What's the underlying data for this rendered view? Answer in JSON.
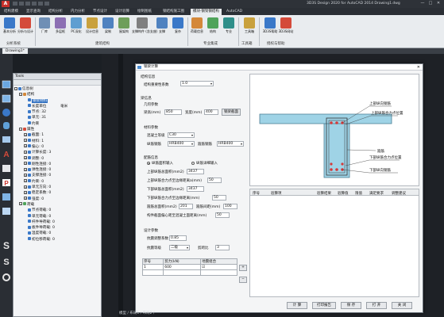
{
  "titlebar": {
    "logo": "A",
    "window_title": "3D3S Design 2020 for AutoCAD 2014   Drawing1.dwg",
    "minimize": "—",
    "maximize": "□",
    "close": "✕"
  },
  "menu_tabs": [
    "结构建模",
    "显示查询",
    "结构分析",
    "内力分析",
    "节点设计",
    "设计验算",
    "绘制图纸",
    "钢结构施工图",
    "模块·钢架钢结构",
    "AutoCAD"
  ],
  "ribbon": {
    "buttons": [
      {
        "label": "基本分析",
        "color": "#3a78c8"
      },
      {
        "label": "分析与设计",
        "color": "#d44a3a"
      },
      {
        "label": "厂库",
        "color": "#6f8fb5"
      },
      {
        "label": "多层框",
        "color": "#8c6fb3"
      },
      {
        "label": "PC深化",
        "color": "#5f9ed1"
      },
      {
        "label": "设计信息",
        "color": "#c9a13d"
      },
      {
        "label": "梁制",
        "color": "#4f82c0"
      },
      {
        "label": "屋架构",
        "color": "#6e9e5a"
      },
      {
        "label": "支撑构件 (含支座)",
        "color": "#7f7f7f"
      },
      {
        "label": "支撑",
        "color": "#4f82c0"
      },
      {
        "label": "复杂",
        "color": "#3a78c8"
      },
      {
        "label": "荷载信息",
        "color": "#d4883a"
      },
      {
        "label": "结构",
        "color": "#4fa35a"
      },
      {
        "label": "专业",
        "color": "#2f8f8a"
      },
      {
        "label": "工具箱",
        "color": "#c9a13d"
      },
      {
        "label": "3D3S帮助",
        "color": "#3a78c8"
      },
      {
        "label": "3D3S网站",
        "color": "#d44a3a"
      }
    ],
    "groups": [
      "分析系统",
      "建筑结构",
      "专业集成",
      "工具箱",
      "授权与帮助"
    ]
  },
  "doc_tab": "Drawing1*",
  "panel": {
    "title": "Tools",
    "tree": [
      {
        "indent": 0,
        "box": "−",
        "text": "信息树",
        "value": "",
        "icon": "#3a78c8"
      },
      {
        "indent": 1,
        "box": "−",
        "text": "结构",
        "value": "",
        "icon": "#d4883a"
      },
      {
        "indent": 2,
        "box": "",
        "text": "钢架材料",
        "value": "",
        "icon": "#3a78c8",
        "selected": true
      },
      {
        "indent": 2,
        "box": "",
        "text": "长度单位",
        "value": "毫米",
        "icon": "#3a78c8"
      },
      {
        "indent": 2,
        "box": "",
        "text": "节点: 32",
        "value": "",
        "icon": "#3a78c8"
      },
      {
        "indent": 2,
        "box": "",
        "text": "单元: 31",
        "value": "",
        "icon": "#3a78c8"
      },
      {
        "indent": 2,
        "box": "",
        "text": "约束",
        "value": "",
        "icon": "#3a78c8"
      },
      {
        "indent": 1,
        "box": "−",
        "text": "属性",
        "value": "",
        "icon": "#d44a3a"
      },
      {
        "indent": 2,
        "box": "+",
        "text": "截面: 1",
        "value": "",
        "icon": "#3a78c8"
      },
      {
        "indent": 2,
        "box": "+",
        "text": "材料: 1",
        "value": "",
        "icon": "#3a78c8"
      },
      {
        "indent": 2,
        "box": "+",
        "text": "偏心: 0",
        "value": "",
        "icon": "#3a78c8"
      },
      {
        "indent": 2,
        "box": "+",
        "text": "计算长度: 3",
        "value": "",
        "icon": "#3a78c8"
      },
      {
        "indent": 2,
        "box": "+",
        "text": "调整: 0",
        "value": "",
        "icon": "#3a78c8"
      },
      {
        "indent": 2,
        "box": "+",
        "text": "刚性连接: 0",
        "value": "",
        "icon": "#3a78c8"
      },
      {
        "indent": 2,
        "box": "+",
        "text": "弹性连接: 0",
        "value": "",
        "icon": "#3a78c8"
      },
      {
        "indent": 2,
        "box": "+",
        "text": "支撑连接: 0",
        "value": "",
        "icon": "#3a78c8"
      },
      {
        "indent": 2,
        "box": "+",
        "text": "约束: 0",
        "value": "",
        "icon": "#3a78c8"
      },
      {
        "indent": 2,
        "box": "+",
        "text": "单元方向: 0",
        "value": "",
        "icon": "#3a78c8"
      },
      {
        "indent": 2,
        "box": "+",
        "text": "稳定系数: 0",
        "value": "",
        "icon": "#3a78c8"
      },
      {
        "indent": 2,
        "box": "+",
        "text": "强度: 0",
        "value": "",
        "icon": "#3a78c8"
      },
      {
        "indent": 1,
        "box": "−",
        "text": "荷载",
        "value": "",
        "icon": "#4fa35a"
      },
      {
        "indent": 2,
        "box": "",
        "text": "节点荷载: 0",
        "value": "",
        "icon": "#3a78c8"
      },
      {
        "indent": 2,
        "box": "",
        "text": "单元荷载: 0",
        "value": "",
        "icon": "#3a78c8"
      },
      {
        "indent": 2,
        "box": "",
        "text": "杆件导荷载: 0",
        "value": "",
        "icon": "#3a78c8"
      },
      {
        "indent": 2,
        "box": "",
        "text": "板件导荷载: 0",
        "value": "",
        "icon": "#3a78c8"
      },
      {
        "indent": 2,
        "box": "",
        "text": "温度荷载: 0",
        "value": "",
        "icon": "#3a78c8"
      },
      {
        "indent": 2,
        "box": "",
        "text": "初位移荷载: 0",
        "value": "",
        "icon": "#3a78c8"
      }
    ]
  },
  "dialog": {
    "title": "钢梁计算",
    "close": "✕",
    "struct_label": "结构信息",
    "struct_factor_label": "结构重要性系数",
    "struct_factor_value": "1.0",
    "beam_section": "梁信息",
    "geom_label": "几何参数",
    "height_label": "梁高(mm)",
    "height_value": "850",
    "width_label": "宽度(mm)",
    "width_value": "400",
    "section_button": "钢梁截面",
    "material_label": "材料参数",
    "concrete_label": "混凝土等级",
    "concrete_value": "C30",
    "long_bar_label": "纵筋钢筋",
    "long_bar_value": "HRB400",
    "stirrup_label": "箍筋钢筋",
    "stirrup_value": "HRB400",
    "rebar_section": "配筋信息",
    "radio_1": "纵筋面积输入",
    "radio_2": "纵筋详细输入",
    "top_area_label": "上部纵筋总面积(mm2)",
    "top_area_value": "3437",
    "top_dist_label": "上部纵筋合力点至边缘距离a(mm)",
    "top_dist_value": "50",
    "bottom_area_label": "下部纵筋总面积(mm2)",
    "bottom_area_value": "3437",
    "bottom_dist_label": "下部纵筋合力点至边缘距离(mm)",
    "bottom_dist_value": "50",
    "stirrup_area_label": "箍筋总面积(mm2)",
    "stirrup_area_value": "201",
    "stirrup_spacing_label": "箍筋间距(mm)",
    "stirrup_spacing_value": "100",
    "slab_label": "构件截面偏心距至混凝土面距离(mm)",
    "slab_value": "50",
    "design_section": "设计参数",
    "seismic_factor_label": "抗震调整系数",
    "seismic_factor_value": "0.85",
    "seismic_level_label": "抗震等级",
    "seismic_level_value": "二级",
    "span_label": "剪跨比",
    "span_value": "3",
    "load_table": {
      "headers": [
        "序号",
        "剪力(kN)",
        "地震组合"
      ],
      "rows": [
        [
          "1",
          "600",
          "☑"
        ]
      ]
    },
    "add_button": "+",
    "del_button": "−",
    "sketch_labels": {
      "top_rebar": "上部纵向钢筋",
      "top_dist": "上部纵筋合力点位置",
      "stirrup": "箍筋",
      "bottom_dist": "下部纵筋合力点位置",
      "bottom_rebar": "下部纵向钢筋"
    },
    "result_headers": [
      "序号",
      "验算项",
      "验算结果",
      "验算值",
      "限值",
      "满足要求",
      "调整建议"
    ],
    "footer": {
      "calc": "计 算",
      "print": "打印报告",
      "save": "保 存",
      "open": "打 开",
      "close": "关 闭"
    }
  },
  "command_tabs": "模型 / 布局1 / 布局2 /",
  "watermark": {
    "big": "当下软件园",
    "small": "www.downxia.com"
  }
}
